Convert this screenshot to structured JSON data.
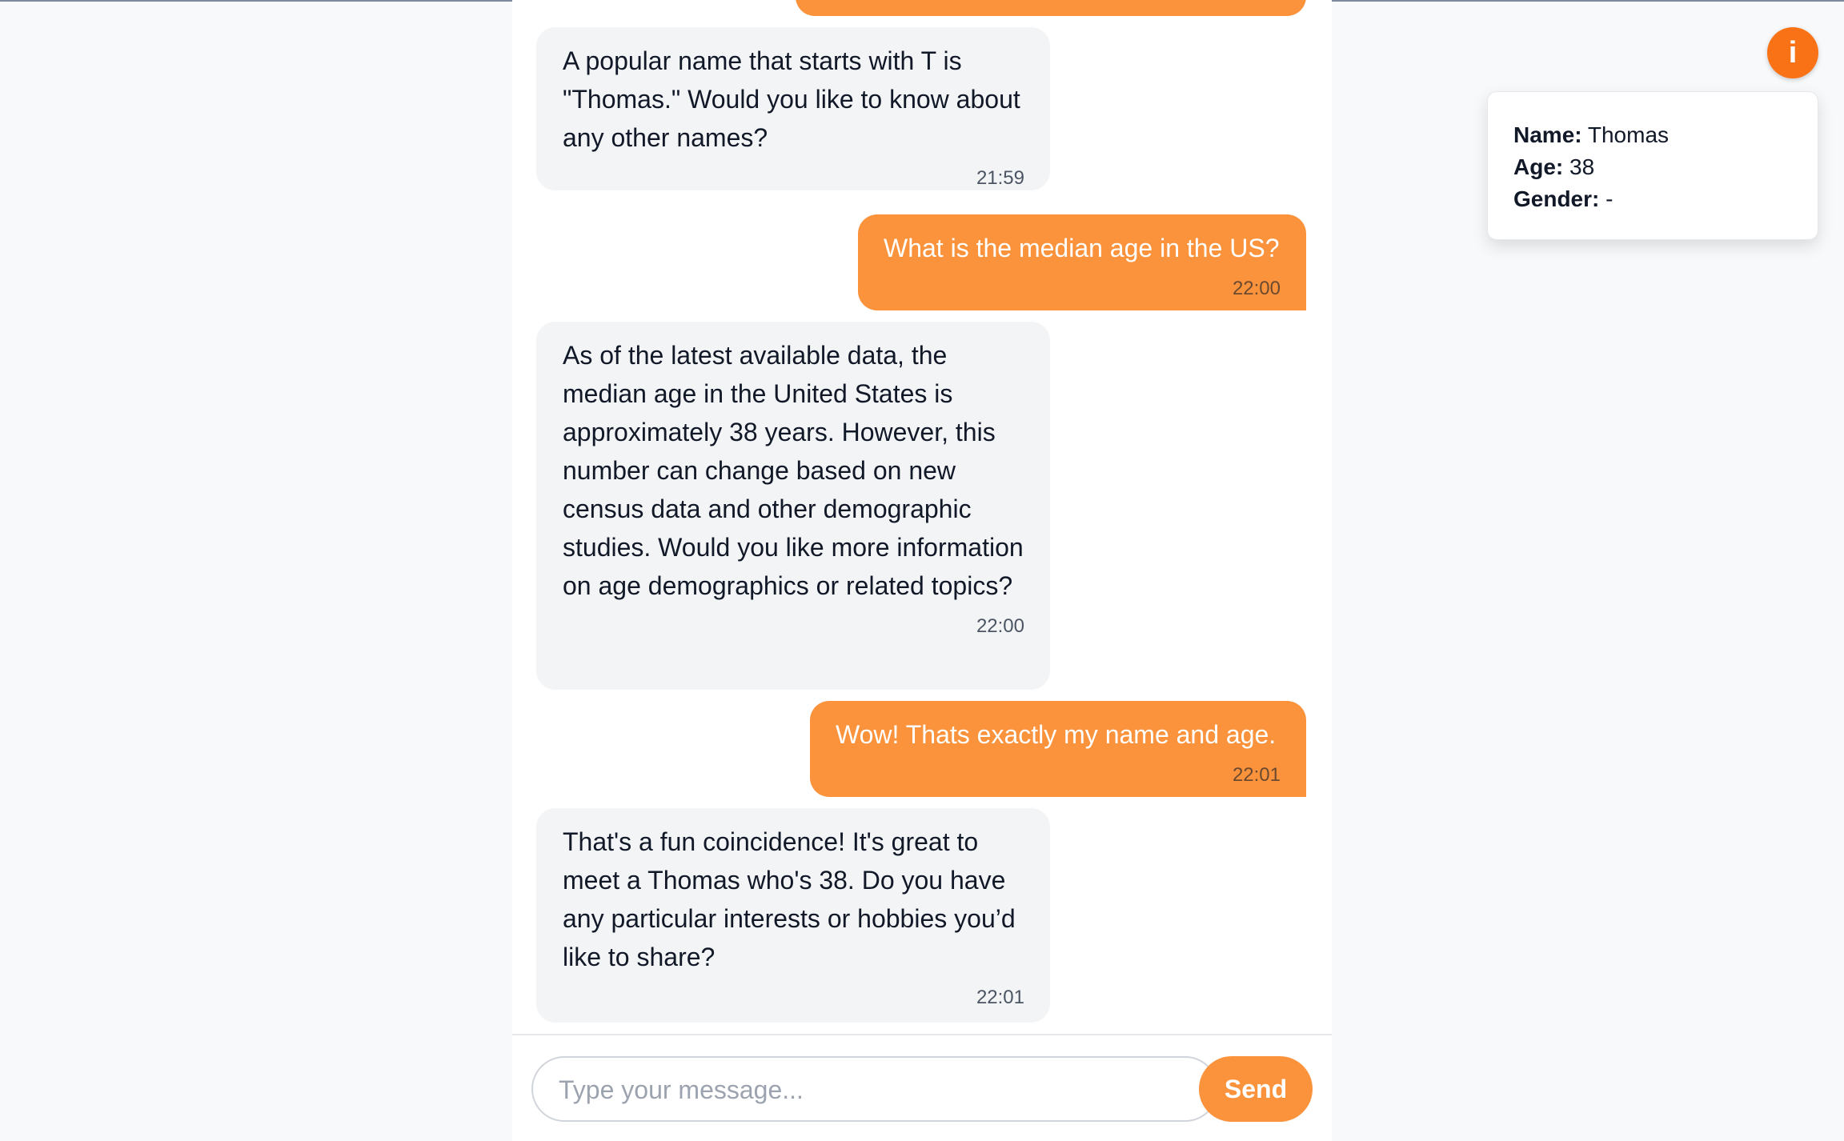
{
  "messages": [
    {
      "role": "bot",
      "text": "A popular name that starts with T is \"Thomas.\" Would you like to know about any other names?",
      "time": "21:59"
    },
    {
      "role": "user",
      "text": "What is the median age in the US?",
      "time": "22:00"
    },
    {
      "role": "bot",
      "text": "As of the latest available data, the median age in the United States is approximately 38 years. However, this number can change based on new census data and other demographic studies. Would you like more information on age demographics or related topics?",
      "time": "22:00"
    },
    {
      "role": "user",
      "text": "Wow! Thats exactly my name and age.",
      "time": "22:01"
    },
    {
      "role": "bot",
      "text": "That's a fun coincidence! It's great to meet a Thomas who's 38. Do you have any particular interests or hobbies you’d like to share?",
      "time": "22:01"
    }
  ],
  "composer": {
    "placeholder": "Type your message...",
    "value": "",
    "send_label": "Send"
  },
  "info": {
    "button_label": "i",
    "name_label": "Name:",
    "name_value": "Thomas",
    "age_label": "Age:",
    "age_value": "38",
    "gender_label": "Gender:",
    "gender_value": "-"
  },
  "colors": {
    "accent": "#fb923c",
    "info_button": "#f97316",
    "bot_bubble": "#f3f4f6",
    "background": "#f7f9fb"
  }
}
